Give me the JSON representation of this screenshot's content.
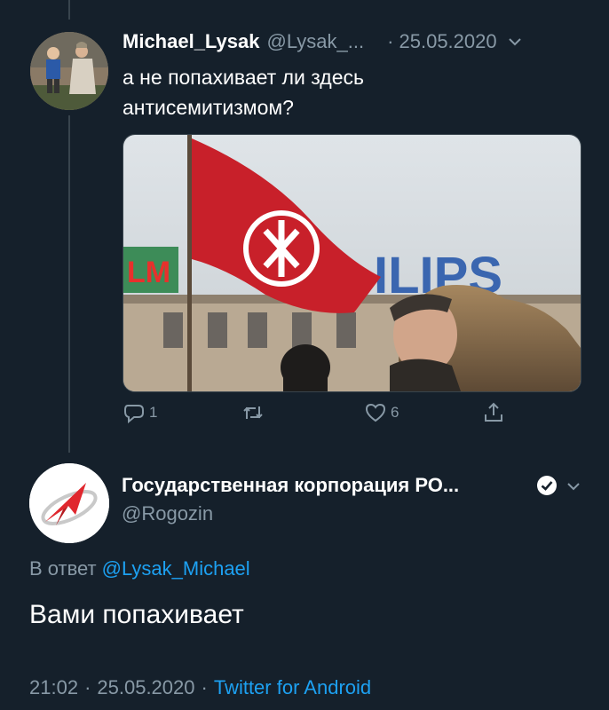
{
  "tweet1": {
    "name": "Michael_Lysak",
    "handle": "@Lysak_...",
    "date": "· 25.05.2020",
    "text_line1": "а не попахивает ли здесь",
    "text_line2": "антисемитизмом?",
    "actions": {
      "reply_count": "1",
      "retweet_count": "",
      "like_count": "6"
    },
    "media": {
      "sign_left": "LM",
      "sign_right": "ILIPS"
    }
  },
  "tweet2": {
    "name": "Государственная корпорация РО...",
    "handle": "@Rogozin",
    "reply_prefix": "В ответ",
    "reply_mention": "@Lysak_Michael",
    "text": "Вами попахивает",
    "time": "21:02",
    "date": "25.05.2020",
    "source": "Twitter for Android"
  },
  "colors": {
    "background": "#15202b",
    "secondary_text": "#8899a6",
    "link": "#1da1f2",
    "flag_red": "#c8202a",
    "logo_red": "#e0272e"
  },
  "icons": [
    "reply-icon",
    "retweet-icon",
    "like-icon",
    "share-icon",
    "verified-icon",
    "chevron-down-icon"
  ]
}
